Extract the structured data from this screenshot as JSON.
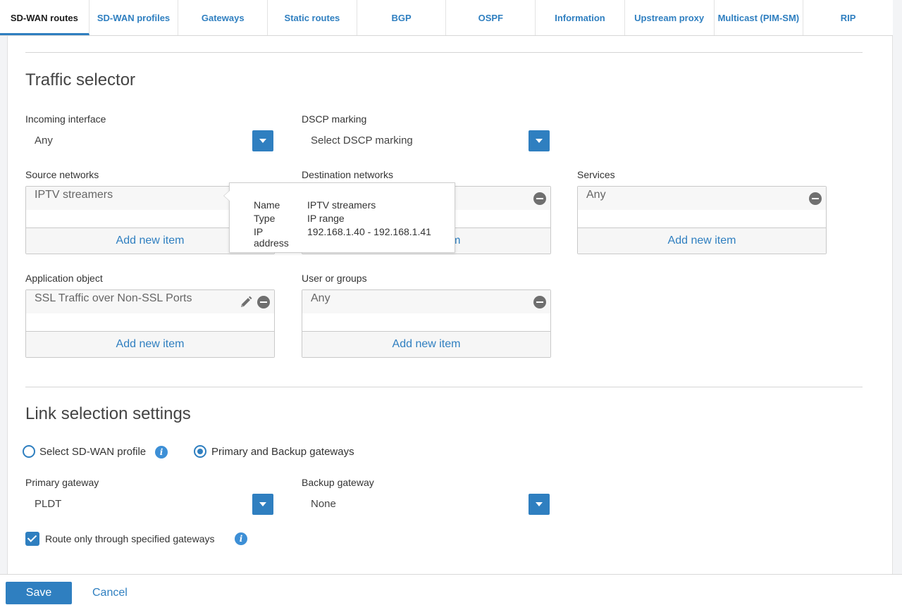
{
  "tabs": [
    {
      "label": "SD-WAN routes",
      "active": true
    },
    {
      "label": "SD-WAN profiles"
    },
    {
      "label": "Gateways"
    },
    {
      "label": "Static routes"
    },
    {
      "label": "BGP"
    },
    {
      "label": "OSPF"
    },
    {
      "label": "Information"
    },
    {
      "label": "Upstream proxy"
    },
    {
      "label": "Multicast (PIM-SM)"
    },
    {
      "label": "RIP"
    }
  ],
  "traffic_selector": {
    "title": "Traffic selector",
    "incoming_interface": {
      "label": "Incoming interface",
      "value": "Any"
    },
    "dscp_marking": {
      "label": "DSCP marking",
      "placeholder": "Select DSCP marking"
    },
    "source_networks": {
      "label": "Source networks",
      "item": "IPTV streamers",
      "add_label": "Add new item"
    },
    "destination_networks": {
      "label": "Destination networks",
      "add_label": "Add new item"
    },
    "services": {
      "label": "Services",
      "item": "Any",
      "add_label": "Add new item"
    },
    "application_object": {
      "label": "Application object",
      "item": "SSL Traffic over Non-SSL Ports",
      "add_label": "Add new item"
    },
    "users_groups": {
      "label": "User or groups",
      "item": "Any",
      "add_label": "Add new item"
    }
  },
  "tooltip": {
    "name_key": "Name",
    "name_value": "IPTV streamers",
    "type_key": "Type",
    "type_value": "IP range",
    "ip_key": "IP address",
    "ip_value": "192.168.1.40 - 192.168.1.41"
  },
  "link_selection": {
    "title": "Link selection settings",
    "radio_sdwan_profile": "Select SD-WAN profile",
    "radio_primary_backup": "Primary and Backup gateways",
    "selected": "Primary and Backup gateways",
    "primary_gateway": {
      "label": "Primary gateway",
      "value": "PLDT"
    },
    "backup_gateway": {
      "label": "Backup gateway",
      "value": "None"
    },
    "route_only_label": "Route only through specified gateways",
    "route_only_checked": true
  },
  "footer": {
    "save_label": "Save",
    "cancel_label": "Cancel"
  },
  "icons": {
    "info": "i"
  },
  "colors": {
    "accent": "#2f7fc0",
    "info": "#3d8fd6"
  }
}
